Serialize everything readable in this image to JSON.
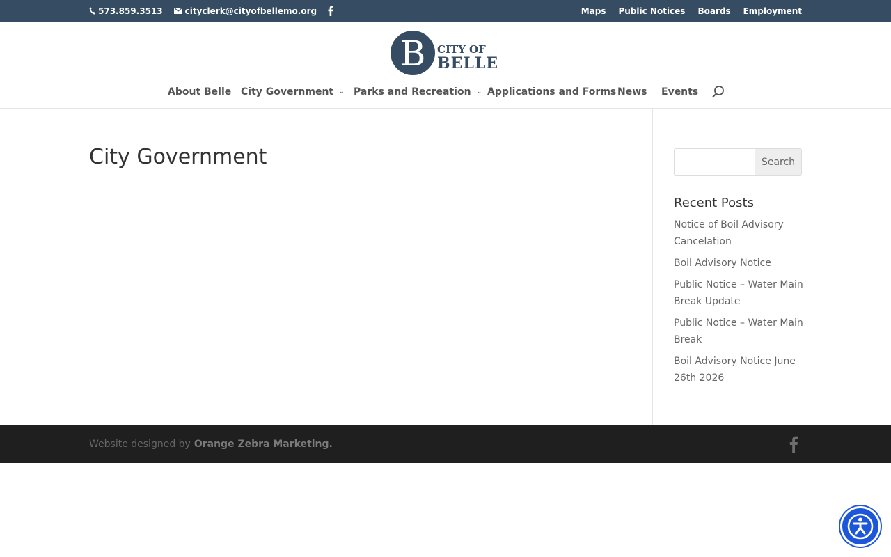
{
  "topbar": {
    "phone": "573.859.3513",
    "email": "cityclerk@cityofbellemo.org",
    "links": [
      "Maps",
      "Public Notices",
      "Boards",
      "Employment"
    ]
  },
  "logo": {
    "initial": "B",
    "line1": "CITY OF",
    "line2": "BELLE"
  },
  "nav": {
    "items": [
      {
        "label": "About Belle",
        "dropdown": false
      },
      {
        "label": "City Government",
        "dropdown": true
      },
      {
        "label": "Parks and Recreation",
        "dropdown": true
      },
      {
        "label": "Applications and Forms",
        "dropdown": false
      },
      {
        "label": "News",
        "dropdown": false
      },
      {
        "label": "Events",
        "dropdown": false
      }
    ]
  },
  "main": {
    "title": "City Government"
  },
  "sidebar": {
    "search_value": "",
    "search_button": "Search",
    "recent_title": "Recent Posts",
    "recent_posts": [
      "Notice of Boil Advisory Cancelation",
      "Boil Advisory Notice",
      "Public Notice – Water Main Break Update",
      "Public Notice – Water Main Break",
      "Boil Advisory Notice June 26th 2026"
    ]
  },
  "footer": {
    "credit_prefix": "Website designed by",
    "credit_link": "Orange Zebra Marketing."
  },
  "colors": {
    "topbar": "#354c62",
    "footer": "#1f1f1f",
    "accessibility": "#1d56d8"
  },
  "icons": [
    "phone-icon",
    "email-icon",
    "facebook-icon",
    "search-icon",
    "chevron-down-icon",
    "accessibility-icon"
  ]
}
